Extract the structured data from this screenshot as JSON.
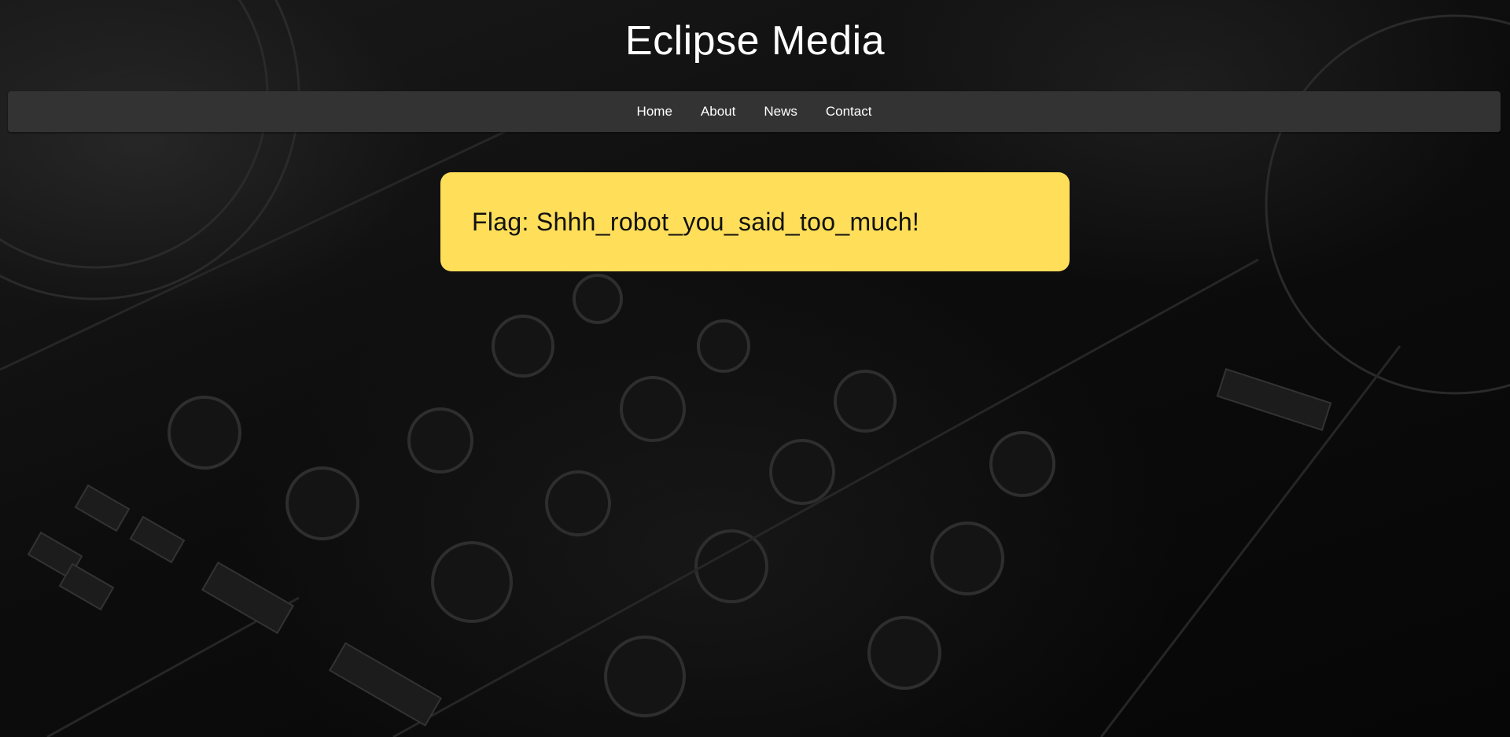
{
  "site": {
    "title": "Eclipse Media"
  },
  "nav": {
    "items": [
      {
        "label": "Home"
      },
      {
        "label": "About"
      },
      {
        "label": "News"
      },
      {
        "label": "Contact"
      }
    ]
  },
  "flag": {
    "text": "Flag: Shhh_robot_you_said_too_much!"
  },
  "colors": {
    "navbar_bg": "#333333",
    "flag_bg": "#ffde59",
    "flag_text": "#111111",
    "title_text": "#ffffff"
  },
  "background": {
    "image": "dj-mixer-icon"
  }
}
